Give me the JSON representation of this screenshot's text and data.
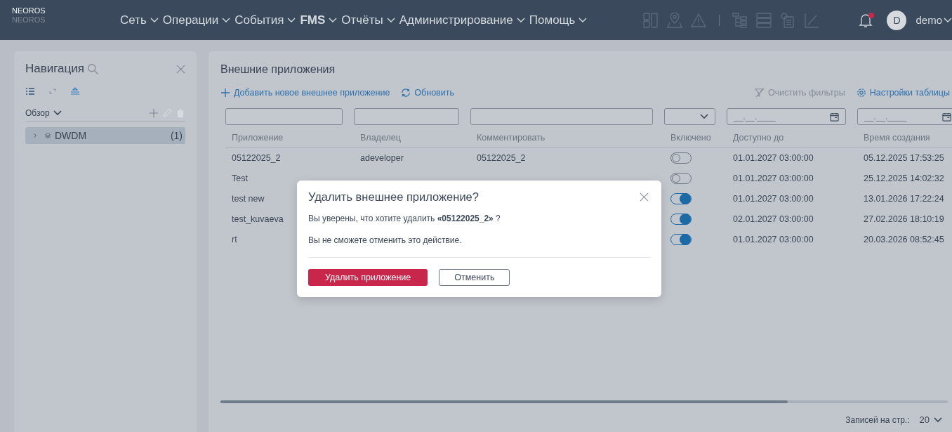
{
  "app": {
    "name": "NEOROS",
    "subtitle": "NEOROS"
  },
  "menu": [
    {
      "label": "Сеть",
      "bold": false
    },
    {
      "label": "Операции",
      "bold": false
    },
    {
      "label": "События",
      "bold": false
    },
    {
      "label": "FMS",
      "bold": true
    },
    {
      "label": "Отчёты",
      "bold": false
    },
    {
      "label": "Администрирование",
      "bold": false
    },
    {
      "label": "Помощь",
      "bold": false
    }
  ],
  "user": {
    "initial": "D",
    "name": "demo",
    "has_notifications": true
  },
  "navigation": {
    "title": "Навигация",
    "section": "Обзор",
    "items": [
      {
        "label": "DWDM",
        "count": "(1)",
        "selected": true
      }
    ]
  },
  "main": {
    "title": "Внешние приложения",
    "add": "Добавить новое внешнее приложение",
    "refresh": "Обновить",
    "clear_filters": "Очистить фильтры",
    "settings": "Настройки таблицы",
    "filters": [
      {
        "kind": "text"
      },
      {
        "kind": "text"
      },
      {
        "kind": "text"
      },
      {
        "kind": "select"
      },
      {
        "kind": "date",
        "placeholder": "__.__.____"
      },
      {
        "kind": "date",
        "placeholder": "__.__.____"
      }
    ],
    "columns": [
      "Приложение",
      "Владелец",
      "Комментировать",
      "Включено",
      "Доступно до",
      "Время создания"
    ],
    "rows": [
      {
        "app": "05122025_2",
        "owner": "adeveloper",
        "comment": "05122025_2",
        "enabled": false,
        "until": "01.01.2027 03:00:00",
        "created": "05.12.2025 17:53:25"
      },
      {
        "app": "Test",
        "enabled": false,
        "until": "01.01.2027 03:00:00",
        "created": "25.12.2025 14:02:32"
      },
      {
        "app": "test new",
        "enabled": true,
        "until": "01.01.2027 03:00:00",
        "created": "13.01.2026 17:22:24"
      },
      {
        "app": "test_kuvaeva",
        "enabled": true,
        "until": "02.01.2027 03:00:00",
        "created": "27.02.2026 18:10:19"
      },
      {
        "app": "rt",
        "enabled": true,
        "until": "01.01.2027 03:00:00",
        "created": "20.03.2026 08:52:45"
      }
    ],
    "page_size_label": "Записей на стр.:",
    "page_size": "20"
  },
  "dialog": {
    "title": "Удалить внешнее приложение?",
    "question": "Вы уверены, что хотите удалить **«05122025_2»** ?",
    "warning": "Вы не сможете отменить это действие.",
    "confirm": "Удалить приложение",
    "cancel": "Отменить"
  }
}
